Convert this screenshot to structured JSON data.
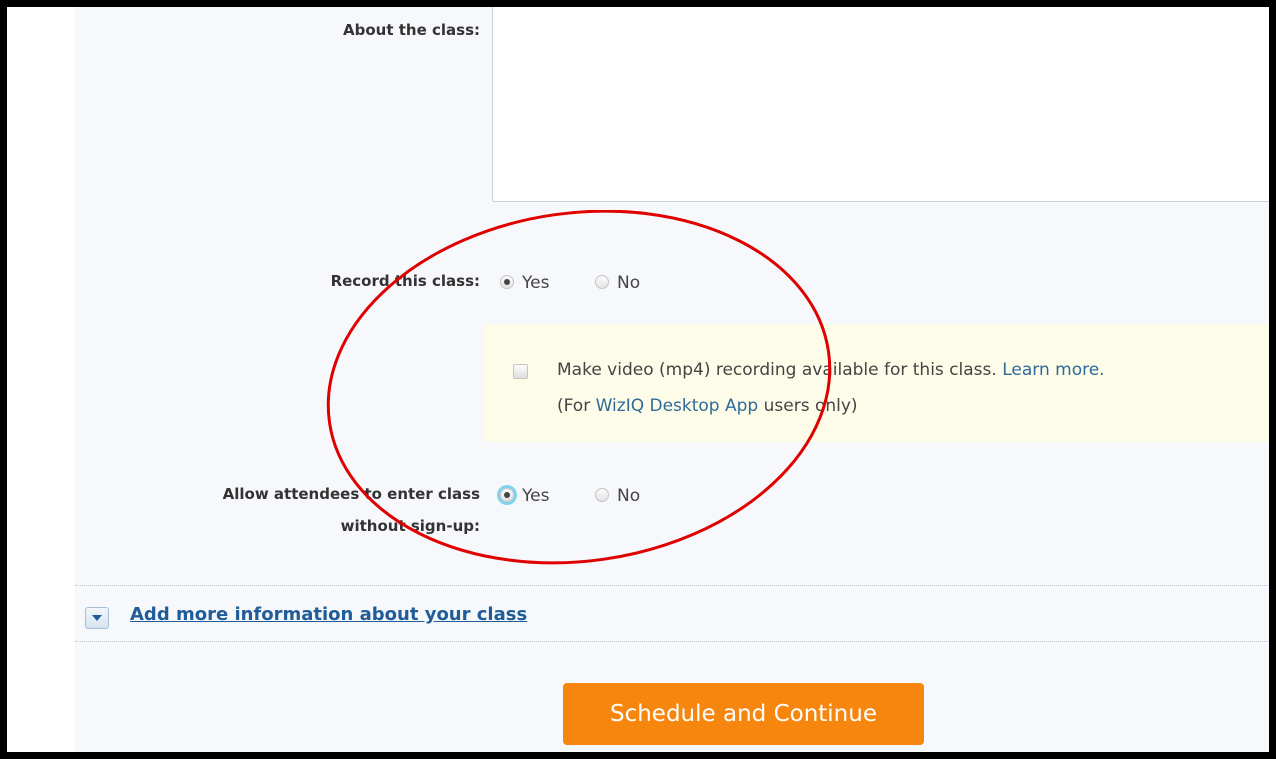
{
  "form": {
    "about_label": "About the class:",
    "record_label": "Record this class:",
    "record_yes": "Yes",
    "record_no": "No",
    "video_note_line1": "Make video (mp4) recording available for this class.",
    "video_learn_more": "Learn more.",
    "video_note_line2_prefix": "(For",
    "video_note_app_link": "WizIQ Desktop App",
    "video_note_line2_suffix": "users only)",
    "allow_label_line1": "Allow attendees to enter class",
    "allow_label_line2": "without sign-up:",
    "allow_yes": "Yes",
    "allow_no": "No",
    "more_info_link": "Add more information about your class",
    "submit_label": "Schedule and Continue"
  },
  "state": {
    "record_selected": "Yes",
    "allow_selected": "Yes",
    "video_checkbox_checked": false
  },
  "colors": {
    "accent_orange": "#f7860e",
    "link_blue": "#2f6a9a",
    "annotation_red": "#e00000",
    "note_background": "#fcfce8"
  }
}
